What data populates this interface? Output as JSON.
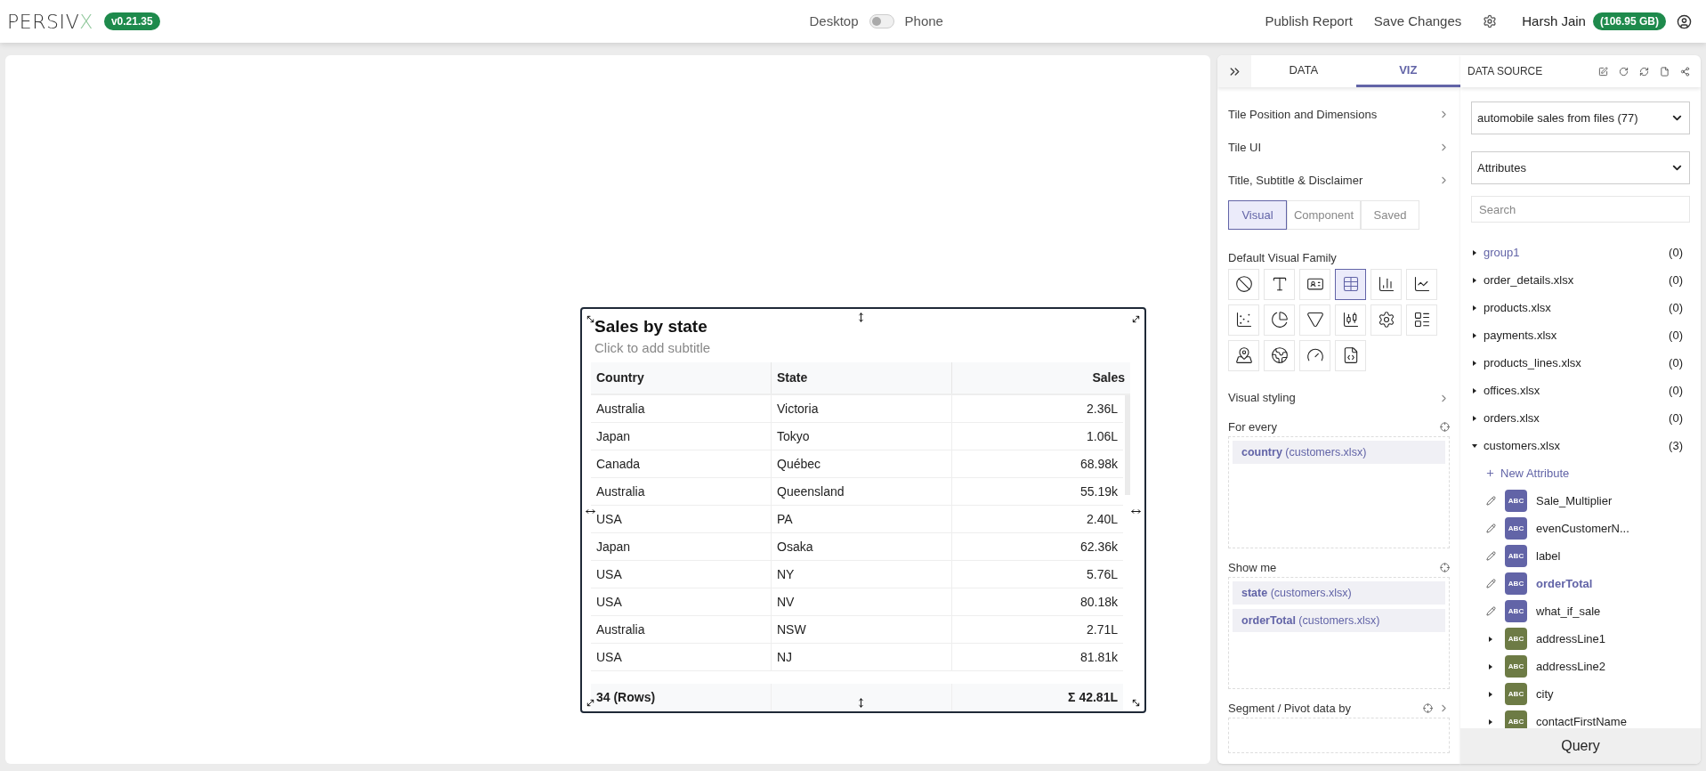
{
  "header": {
    "logo": {
      "text": "PERSIV",
      "accent": "X"
    },
    "version": "v0.21.35",
    "view_toggle": {
      "left": "Desktop",
      "right": "Phone",
      "on": false
    },
    "actions": [
      "Publish Report",
      "Save Changes"
    ],
    "user": "Harsh Jain",
    "storage": "(106.95 GB)"
  },
  "tile": {
    "title": "Sales by state",
    "subtitle": "Click to add subtitle",
    "columns": [
      "Country",
      "State",
      "Sales"
    ],
    "rows": [
      [
        "Australia",
        "Victoria",
        "2.36L"
      ],
      [
        "Japan",
        "Tokyo",
        "1.06L"
      ],
      [
        "Canada",
        "Québec",
        "68.98k"
      ],
      [
        "Australia",
        "Queensland",
        "55.19k"
      ],
      [
        "USA",
        "PA",
        "2.40L"
      ],
      [
        "Japan",
        "Osaka",
        "62.36k"
      ],
      [
        "USA",
        "NY",
        "5.76L"
      ],
      [
        "USA",
        "NV",
        "80.18k"
      ],
      [
        "Australia",
        "NSW",
        "2.71L"
      ],
      [
        "USA",
        "NJ",
        "81.81k"
      ]
    ],
    "footer": {
      "rows": "34 (Rows)",
      "total": "Σ 42.81L"
    }
  },
  "viz_panel": {
    "tabs": [
      {
        "label": "DATA",
        "selected": false
      },
      {
        "label": "VIZ",
        "selected": true
      }
    ],
    "sections": [
      "Tile Position and Dimensions",
      "Tile UI",
      "Title, Subtitle & Disclaimer"
    ],
    "modes": [
      {
        "label": "Visual",
        "selected": true
      },
      {
        "label": "Component",
        "selected": false
      },
      {
        "label": "Saved",
        "selected": false
      }
    ],
    "visual_family": {
      "label": "Default Visual Family",
      "items": [
        {
          "kind": "none",
          "selected": false
        },
        {
          "kind": "text",
          "selected": false
        },
        {
          "kind": "card",
          "selected": false
        },
        {
          "kind": "table",
          "selected": true
        },
        {
          "kind": "bar",
          "selected": false
        },
        {
          "kind": "line",
          "selected": false
        },
        {
          "kind": "scatter",
          "selected": false
        },
        {
          "kind": "pie",
          "selected": false
        },
        {
          "kind": "funnel",
          "selected": false
        },
        {
          "kind": "candlestick",
          "selected": false
        },
        {
          "kind": "settings",
          "selected": false
        },
        {
          "kind": "layout",
          "selected": false
        },
        {
          "kind": "map",
          "selected": false
        },
        {
          "kind": "globe",
          "selected": false
        },
        {
          "kind": "gauge",
          "selected": false
        },
        {
          "kind": "script",
          "selected": false
        }
      ]
    },
    "styling": "Visual styling",
    "shelves": [
      {
        "label": "For every",
        "expandable": false,
        "pills": [
          "**country** (customers.xlsx)"
        ]
      },
      {
        "label": "Show me",
        "expandable": false,
        "pills": [
          "**state** (customers.xlsx)",
          "**orderTotal** (customers.xlsx)"
        ]
      },
      {
        "label": "Segment / Pivot data by",
        "expandable": true
      }
    ]
  },
  "data_source": {
    "title": "DATA SOURCE",
    "source_select": "automobile sales from files (77)",
    "type_select": "Attributes",
    "search": {
      "placeholder": "Search"
    },
    "tree": [
      {
        "label": "group1",
        "count": "(0)",
        "kind": "group",
        "expanded": false
      },
      {
        "label": "order_details.xlsx",
        "count": "(0)",
        "kind": "file",
        "expanded": false
      },
      {
        "label": "products.xlsx",
        "count": "(0)",
        "kind": "file",
        "expanded": false
      },
      {
        "label": "payments.xlsx",
        "count": "(0)",
        "kind": "file",
        "expanded": false
      },
      {
        "label": "products_lines.xlsx",
        "count": "(0)",
        "kind": "file",
        "expanded": false
      },
      {
        "label": "offices.xlsx",
        "count": "(0)",
        "kind": "file",
        "expanded": false
      },
      {
        "label": "orders.xlsx",
        "count": "(0)",
        "kind": "file",
        "expanded": false
      },
      {
        "label": "customers.xlsx",
        "count": "(3)",
        "kind": "file",
        "expanded": true,
        "children": [
          {
            "kind": "new",
            "label": "New Attribute"
          },
          {
            "kind": "custom",
            "type_label": "ABC",
            "label": "Sale_Multiplier",
            "in_use": false
          },
          {
            "kind": "custom",
            "type_label": "ABC",
            "label": "evenCustomerN...",
            "in_use": false
          },
          {
            "kind": "custom",
            "type_label": "ABC",
            "label": "label",
            "in_use": false
          },
          {
            "kind": "custom",
            "type_label": "ABC",
            "label": "orderTotal",
            "in_use": true
          },
          {
            "kind": "custom",
            "type_label": "ABC",
            "label": "what_if_sale",
            "in_use": false
          },
          {
            "kind": "field",
            "type_label": "ABC",
            "label": "addressLine1",
            "in_use": false
          },
          {
            "kind": "field",
            "type_label": "ABC",
            "label": "addressLine2",
            "in_use": false
          },
          {
            "kind": "field",
            "type_label": "ABC",
            "label": "city",
            "in_use": false
          },
          {
            "kind": "field",
            "type_label": "ABC",
            "label": "contactFirstName",
            "in_use": false
          }
        ]
      }
    ],
    "query_button": "Query"
  }
}
